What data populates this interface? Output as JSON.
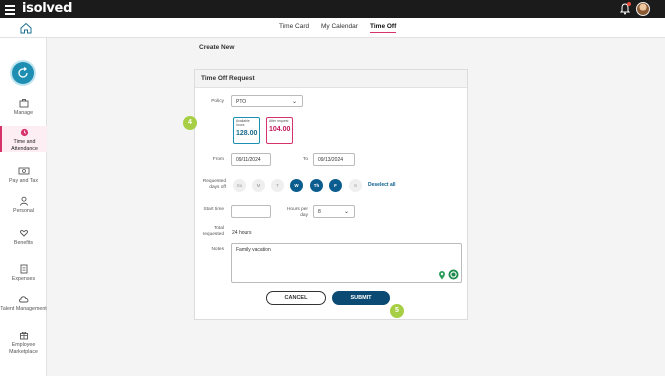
{
  "app": {
    "logo": "isolved"
  },
  "colors": {
    "accent": "#d6336c",
    "primary": "#0b5d8f",
    "callout": "#a7cf45"
  },
  "tabs": [
    {
      "label": "Time Card",
      "active": false
    },
    {
      "label": "My Calendar",
      "active": false
    },
    {
      "label": "Time Off",
      "active": true
    }
  ],
  "sidebar": {
    "items": [
      {
        "label": "Manage",
        "icon": "briefcase-icon"
      },
      {
        "label": "Time and Attendance",
        "icon": "clock-icon",
        "active": true
      },
      {
        "label": "Pay and Tax",
        "icon": "money-icon"
      },
      {
        "label": "Personal",
        "icon": "person-icon"
      },
      {
        "label": "Benefits",
        "icon": "heart-hand-icon"
      },
      {
        "label": "Expenses",
        "icon": "receipt-icon"
      },
      {
        "label": "Talent Management",
        "icon": "cloud-icon"
      },
      {
        "label": "Employee Marketplace",
        "icon": "gift-icon"
      }
    ]
  },
  "page": {
    "create_new": "Create New",
    "card_title": "Time Off Request",
    "policy": {
      "label": "Policy",
      "value": "PTO"
    },
    "available": {
      "caption": "Available hours",
      "value": "128.00"
    },
    "after": {
      "caption": "After request",
      "value": "104.00"
    },
    "from": {
      "label": "From",
      "value": "09/11/2024"
    },
    "to": {
      "label": "To",
      "value": "09/13/2024"
    },
    "requested_days": {
      "label": "Requested days off",
      "days": [
        {
          "label": "Su",
          "selected": false
        },
        {
          "label": "M",
          "selected": false
        },
        {
          "label": "T",
          "selected": false
        },
        {
          "label": "W",
          "selected": true
        },
        {
          "label": "Th",
          "selected": true
        },
        {
          "label": "F",
          "selected": true
        },
        {
          "label": "S",
          "selected": false
        }
      ],
      "deselect_all": "Deselect all"
    },
    "start_time": {
      "label": "Start time",
      "value": ""
    },
    "hours_per_day": {
      "label": "Hours per day",
      "value": "8"
    },
    "total_requested": {
      "label": "Total requested",
      "value": "24 hours"
    },
    "notes": {
      "label": "Notes",
      "value": "Family vacation"
    },
    "buttons": {
      "cancel": "CANCEL",
      "submit": "SUBMIT"
    },
    "callouts": {
      "step4": "4",
      "step5": "5"
    }
  }
}
